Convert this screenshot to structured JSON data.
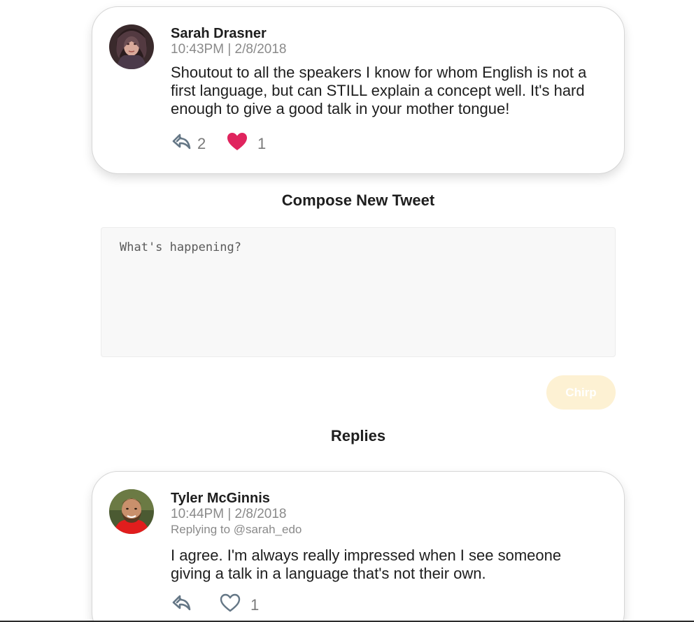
{
  "main_tweet": {
    "author": "Sarah Drasner",
    "date": "10:43PM | 2/8/2018",
    "text": "Shoutout to all the speakers I know for whom English is not a first language, but can STILL explain a concept well. It's hard enough to give a good talk in your mother tongue!",
    "reply_count": "2",
    "like_count": "1",
    "liked": true,
    "reply_icon": "reply-icon",
    "like_icon": "heart-filled-icon"
  },
  "compose": {
    "title": "Compose New Tweet",
    "placeholder": "What's happening?",
    "button_label": "Chirp"
  },
  "replies": {
    "title": "Replies",
    "items": [
      {
        "author": "Tyler McGinnis",
        "date": "10:44PM | 2/8/2018",
        "replying_to": "Replying to @sarah_edo",
        "text": "I agree. I'm always really impressed when I see someone giving a talk in a language that's not their own.",
        "reply_count": "",
        "like_count": "1",
        "liked": false,
        "reply_icon": "reply-icon",
        "like_icon": "heart-outline-icon"
      }
    ]
  },
  "colors": {
    "like_active": "#e0245e",
    "icon_gray": "#657786",
    "chirp_disabled": "#fdf1d3"
  }
}
